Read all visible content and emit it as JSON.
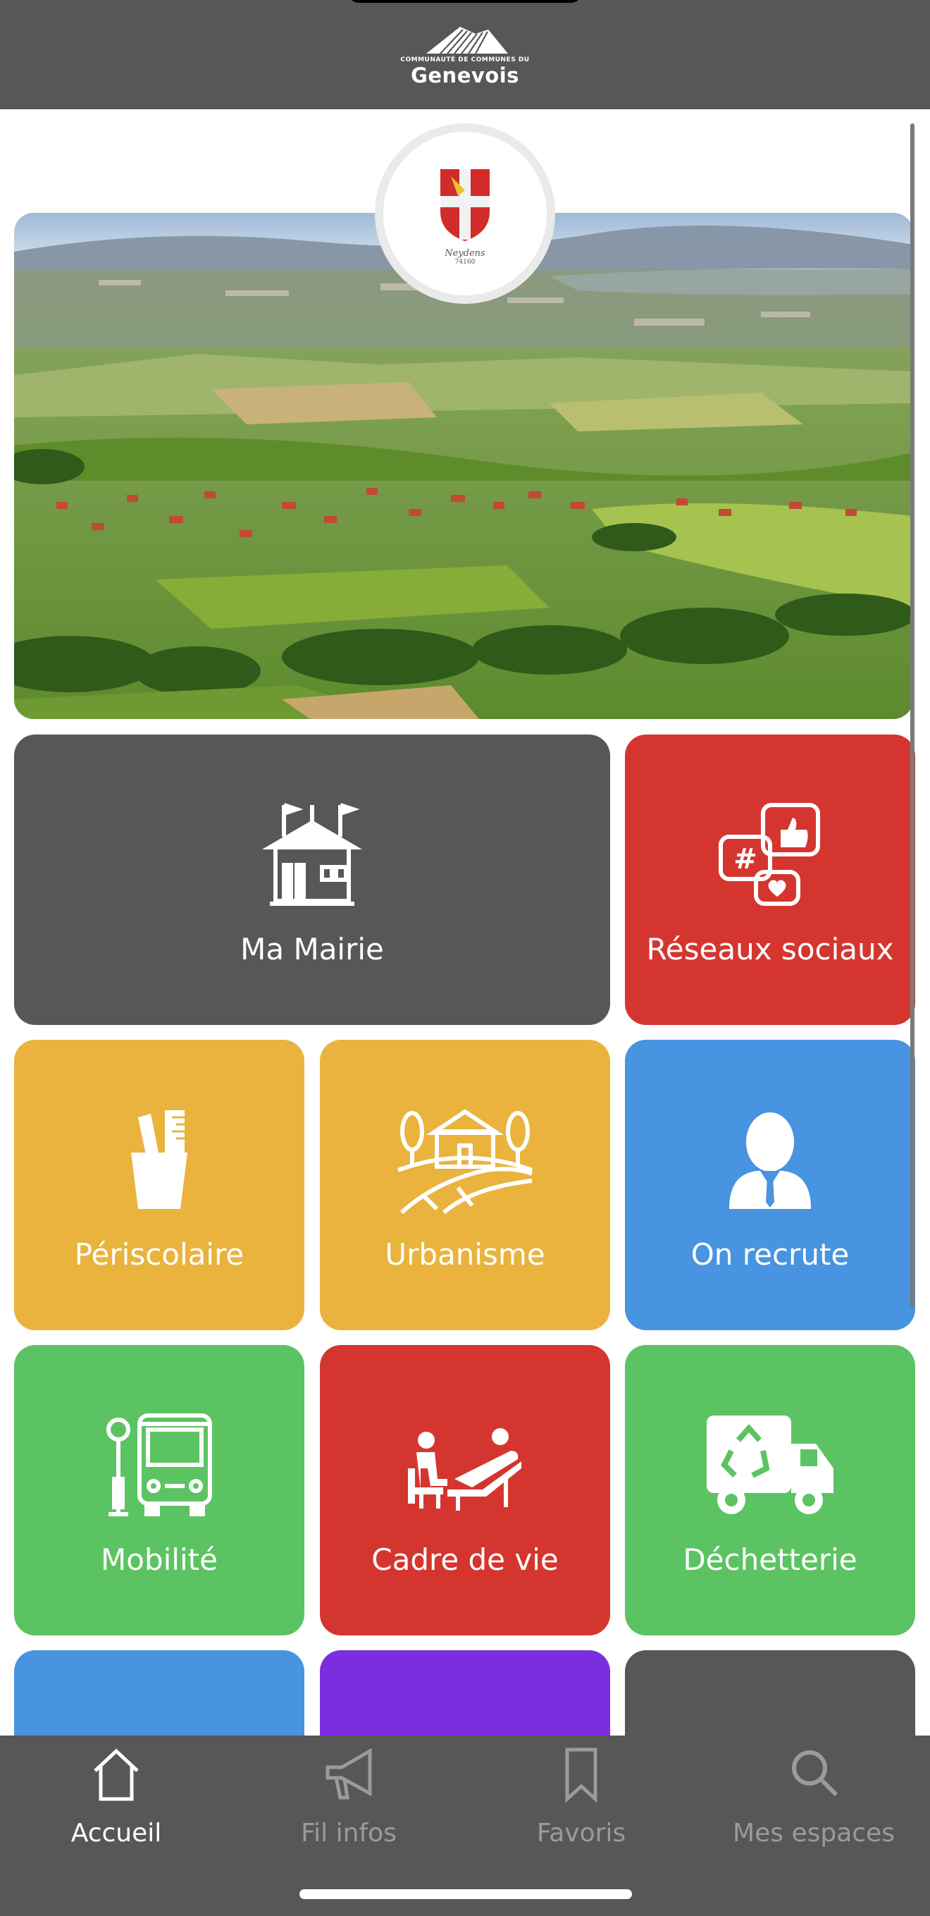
{
  "header": {
    "logo_small": "COMMUNAUTÉ DE COMMUNES DU",
    "logo_big": "Genevois"
  },
  "crest": {
    "name": "Neydens",
    "code": "74160"
  },
  "tiles": [
    {
      "label": "Ma Mairie",
      "color": "#575757",
      "icon": "town-hall-icon"
    },
    {
      "label": "Réseaux sociaux",
      "color": "#d4362f",
      "icon": "social-media-icon"
    },
    {
      "label": "Périscolaire",
      "color": "#e9b33e",
      "icon": "pencil-cup-icon"
    },
    {
      "label": "Urbanisme",
      "color": "#e9b33e",
      "icon": "village-landscape-icon"
    },
    {
      "label": "On recrute",
      "color": "#4894e0",
      "icon": "businessman-icon"
    },
    {
      "label": "Mobilité",
      "color": "#5cc363",
      "icon": "bus-stop-icon"
    },
    {
      "label": "Cadre de vie",
      "color": "#d4362f",
      "icon": "relaxation-icon"
    },
    {
      "label": "Déchetterie",
      "color": "#5cc363",
      "icon": "recycling-truck-icon"
    },
    {
      "label": "",
      "color": "#4894e0",
      "icon": "partial-icon"
    },
    {
      "label": "",
      "color": "#7b2ee0",
      "icon": "partial-icon"
    },
    {
      "label": "",
      "color": "#575757",
      "icon": "partial-icon"
    }
  ],
  "tabbar": {
    "items": [
      {
        "label": "Accueil",
        "icon": "home-icon",
        "active": true
      },
      {
        "label": "Fil infos",
        "icon": "megaphone-icon",
        "active": false
      },
      {
        "label": "Favoris",
        "icon": "bookmark-icon",
        "active": false
      },
      {
        "label": "Mes espaces",
        "icon": "search-icon",
        "active": false
      }
    ],
    "active_color": "#ffffff",
    "inactive_color": "#9b9b9b"
  }
}
